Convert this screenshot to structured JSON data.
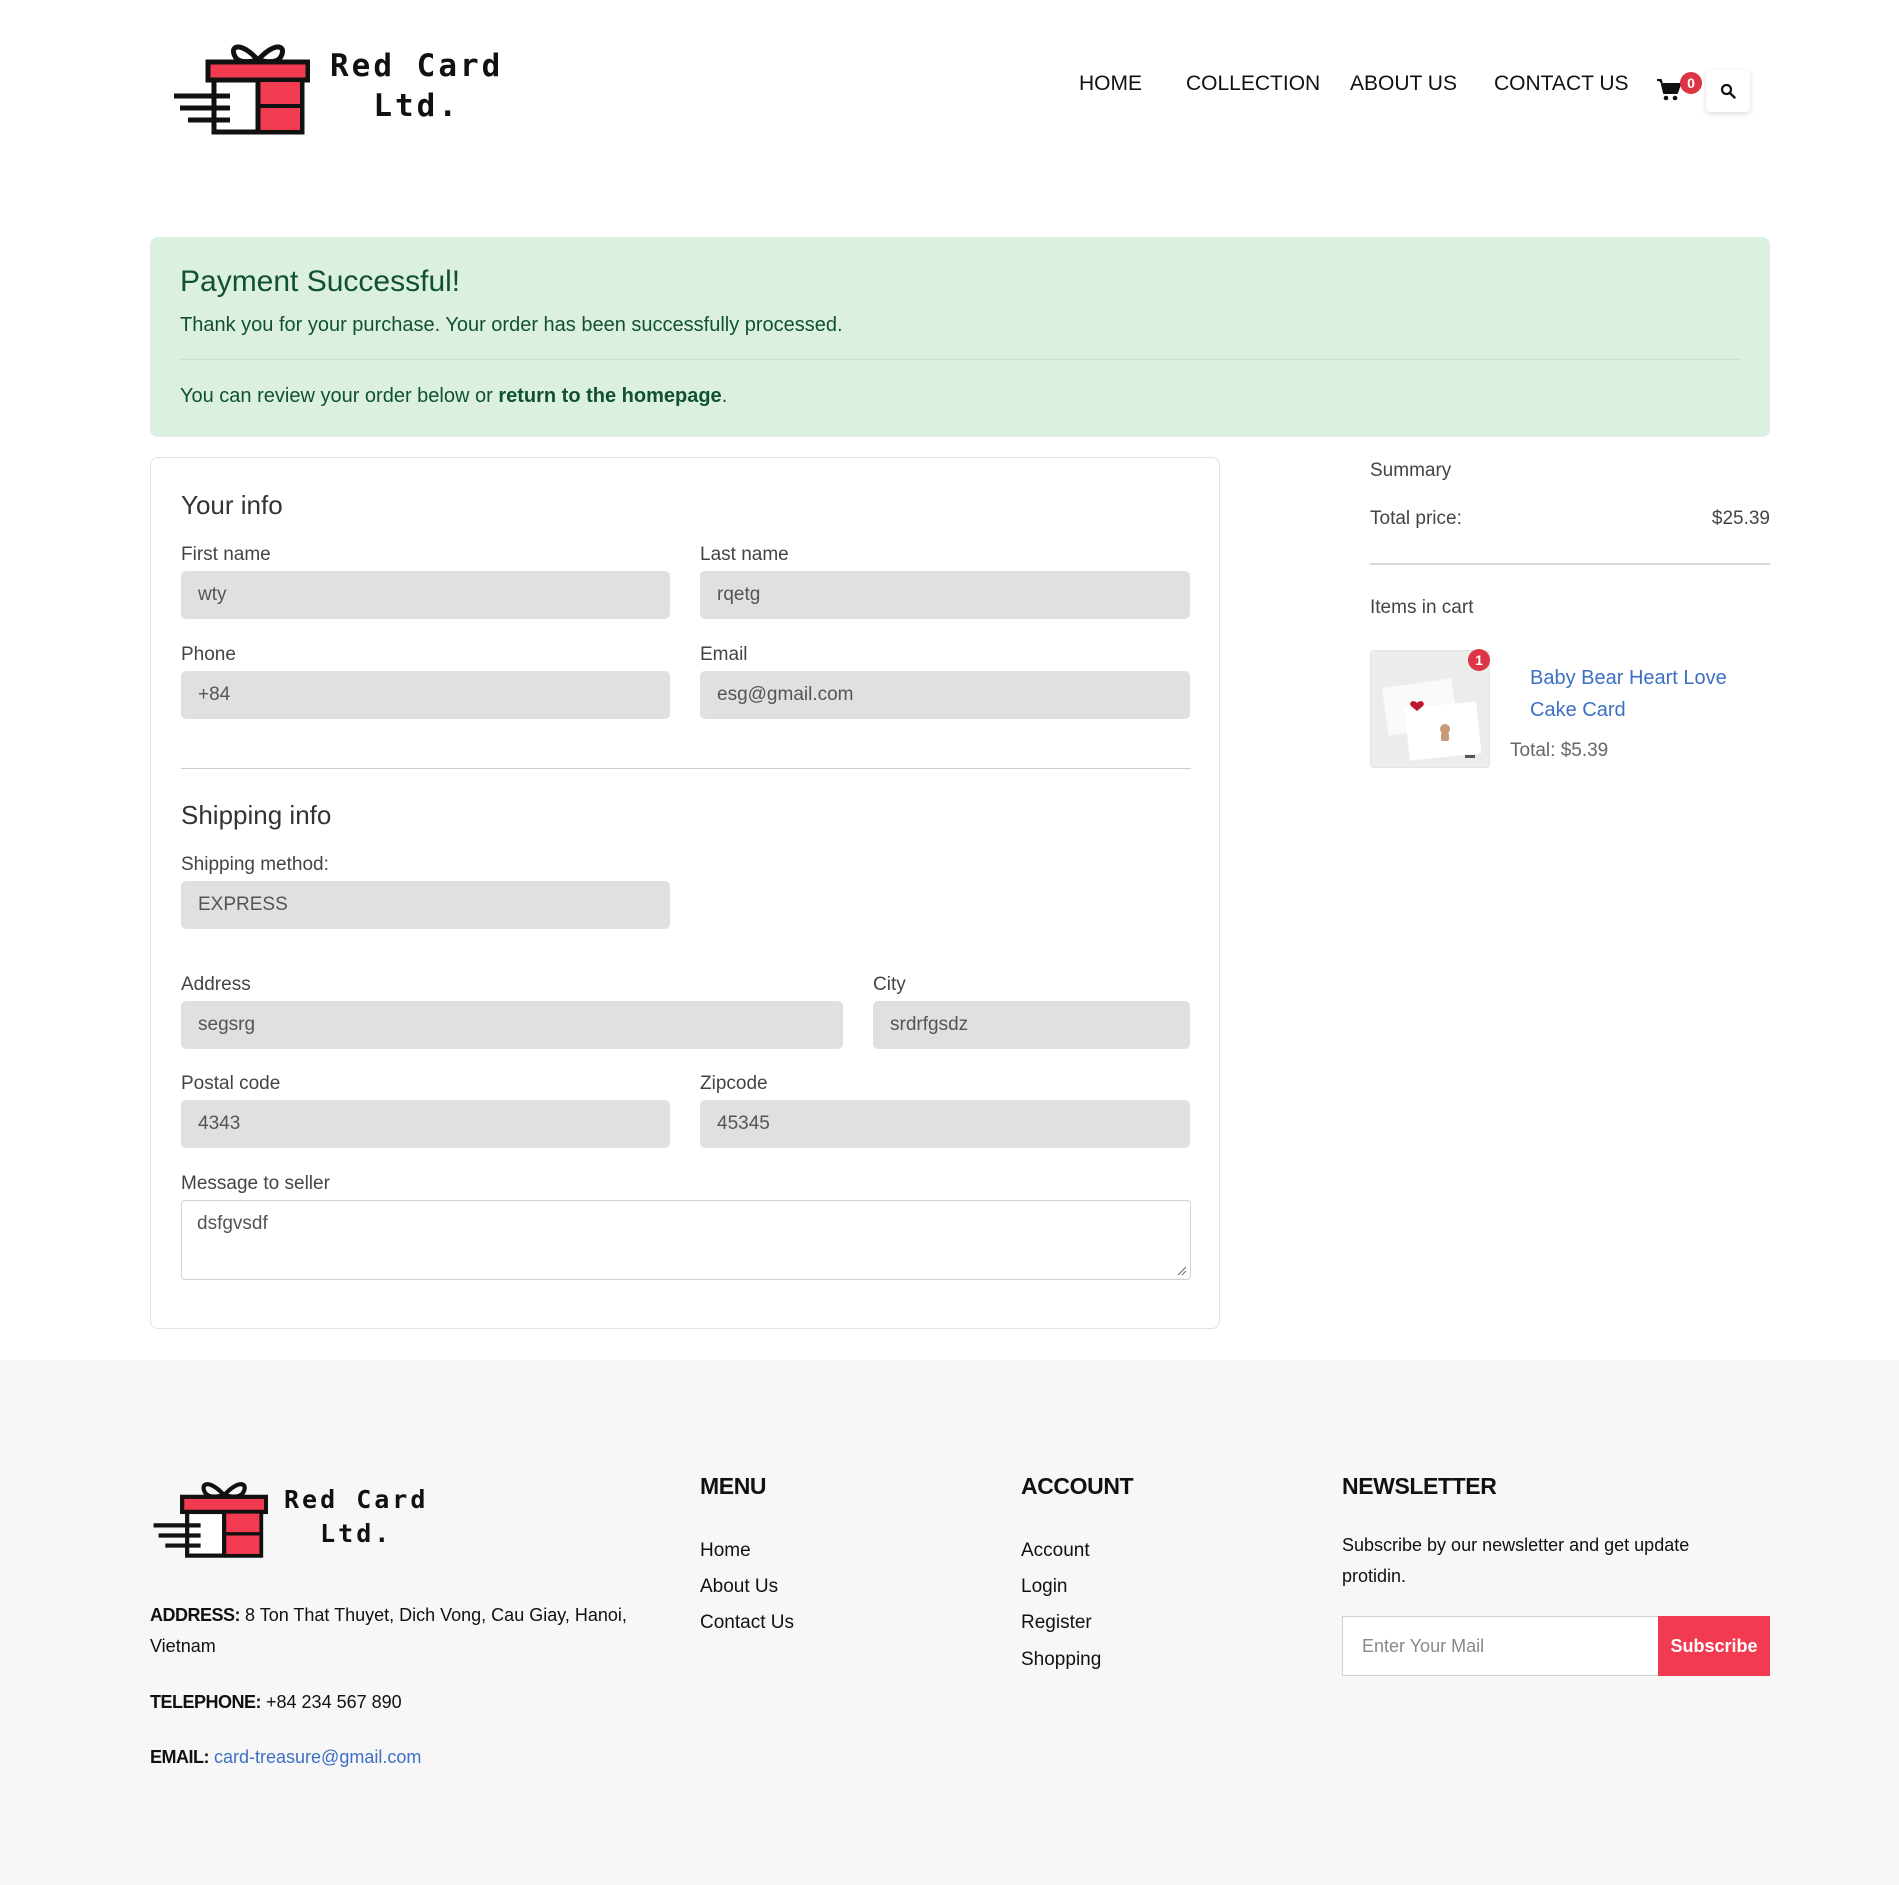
{
  "brand": {
    "name_line1": "Red Card",
    "name_line2": "Ltd.",
    "logo_icon": "gift-box-icon",
    "accent": "#f23a50"
  },
  "nav": {
    "items": [
      {
        "label": "HOME"
      },
      {
        "label": "COLLECTION"
      },
      {
        "label": "ABOUT US"
      },
      {
        "label": "CONTACT US"
      }
    ],
    "cart_count": "0",
    "cart_icon": "cart-icon",
    "search_icon": "search-icon"
  },
  "alert": {
    "title": "Payment Successful!",
    "message": "Thank you for your purchase. Your order has been successfully processed.",
    "review_prefix": "You can review your order below or ",
    "review_link": "return to the homepage",
    "review_suffix": ".",
    "color": "#0f5132",
    "background": "#dcf0e1"
  },
  "your_info": {
    "title": "Your info",
    "first_name_label": "First name",
    "first_name": "wty",
    "last_name_label": "Last name",
    "last_name": "rqetg",
    "phone_label": "Phone",
    "phone": "+84",
    "email_label": "Email",
    "email": "esg@gmail.com"
  },
  "shipping_info": {
    "title": "Shipping info",
    "method_label": "Shipping method:",
    "method": "EXPRESS",
    "address_label": "Address",
    "address": "segsrg",
    "city_label": "City",
    "city": "srdrfgsdz",
    "postal_label": "Postal code",
    "postal": "4343",
    "zip_label": "Zipcode",
    "zip": "45345",
    "message_label": "Message to seller",
    "message": "dsfgvsdf"
  },
  "summary": {
    "title": "Summary",
    "total_label": "Total price:",
    "total_value": "$25.39",
    "items_title": "Items in cart",
    "items": [
      {
        "name": "Baby Bear Heart Love Cake Card",
        "qty": "1",
        "total": "Total: $5.39"
      }
    ]
  },
  "footer": {
    "address_label": "ADDRESS:",
    "address": " 8 Ton That Thuyet, Dich Vong, Cau Giay, Hanoi, Vietnam",
    "phone_label": "TELEPHONE:",
    "phone": " +84 234 567 890",
    "email_label": "EMAIL:",
    "email": "card-treasure@gmail.com",
    "menu_title": "MENU",
    "menu": [
      "Home",
      "About Us",
      "Contact Us"
    ],
    "account_title": "ACCOUNT",
    "account": [
      "Account",
      "Login",
      "Register",
      "Shopping"
    ],
    "newsletter_title": "NEWSLETTER",
    "newsletter_text": "Subscribe by our newsletter and get update protidin.",
    "newsletter_placeholder": "Enter Your Mail",
    "subscribe_label": "Subscribe"
  }
}
